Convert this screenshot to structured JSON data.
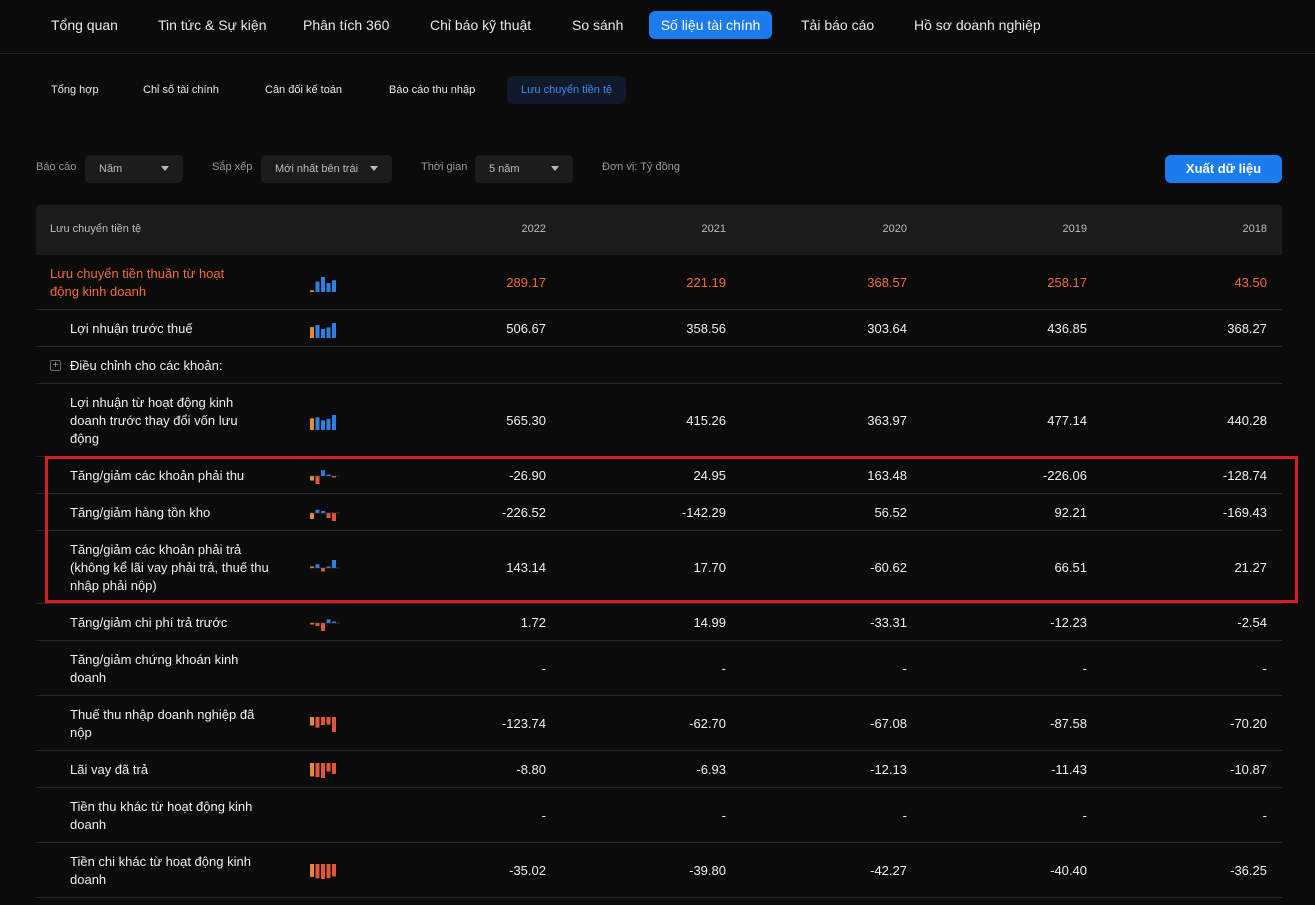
{
  "top_nav": [
    {
      "label": "Tổng quan",
      "active": false
    },
    {
      "label": "Tin tức & Sự kiện",
      "active": false
    },
    {
      "label": "Phân tích 360",
      "active": false
    },
    {
      "label": "Chỉ báo kỹ thuật",
      "active": false
    },
    {
      "label": "So sánh",
      "active": false
    },
    {
      "label": "Số liệu tài chính",
      "active": true
    },
    {
      "label": "Tải báo cáo",
      "active": false
    },
    {
      "label": "Hồ sơ doanh nghiệp",
      "active": false
    }
  ],
  "sub_nav": [
    {
      "label": "Tổng hợp",
      "active": false
    },
    {
      "label": "Chỉ số tài chính",
      "active": false
    },
    {
      "label": "Cân đối kế toán",
      "active": false
    },
    {
      "label": "Báo cáo thu nhập",
      "active": false
    },
    {
      "label": "Lưu chuyển tiền tệ",
      "active": true
    }
  ],
  "filters": {
    "report_label": "Báo cáo",
    "report_value": "Năm",
    "sort_label": "Sắp xếp",
    "sort_value": "Mới nhất bên trái",
    "time_label": "Thời gian",
    "time_value": "5 năm",
    "unit_label": "Đơn vị: Tỷ đồng",
    "export_label": "Xuất dữ liệu"
  },
  "colors": {
    "accent": "#1b7cf0",
    "highlight_text": "#f06a3a",
    "positive_bar": "#2f7fe0",
    "negative_bar": "#e0563a",
    "orange_bar": "#e8892e",
    "highlight_box": "#d71c22"
  },
  "table": {
    "header_label": "Lưu chuyển tiền tệ",
    "years": [
      "2022",
      "2021",
      "2020",
      "2019",
      "2018"
    ],
    "rows": [
      {
        "name": "Lưu chuyển tiền thuần từ hoạt động kinh doanh",
        "values": [
          "289.17",
          "221.19",
          "368.57",
          "258.17",
          "43.50"
        ],
        "spark": true
      },
      {
        "name": "Lợi nhuận trước thuế",
        "values": [
          "506.67",
          "358.56",
          "303.64",
          "436.85",
          "368.27"
        ],
        "spark": true
      },
      {
        "name": "Điều chỉnh cho các khoản:",
        "values": [],
        "spark": false
      },
      {
        "name": "Lợi nhuận từ hoạt động kinh doanh trước thay đổi vốn lưu động",
        "values": [
          "565.30",
          "415.26",
          "363.97",
          "477.14",
          "440.28"
        ],
        "spark": true
      },
      {
        "name": "Tăng/giảm các khoản phải thu",
        "values": [
          "-26.90",
          "24.95",
          "163.48",
          "-226.06",
          "-128.74"
        ],
        "spark": true
      },
      {
        "name": "Tăng/giảm hàng tồn kho",
        "values": [
          "-226.52",
          "-142.29",
          "56.52",
          "92.21",
          "-169.43"
        ],
        "spark": true
      },
      {
        "name": "Tăng/giảm các khoản phải trả (không kể lãi vay phải trả, thuế thu nhập phải nộp)",
        "values": [
          "143.14",
          "17.70",
          "-60.62",
          "66.51",
          "21.27"
        ],
        "spark": true
      },
      {
        "name": "Tăng/giảm chi phí trả trước",
        "values": [
          "1.72",
          "14.99",
          "-33.31",
          "-12.23",
          "-2.54"
        ],
        "spark": true
      },
      {
        "name": "Tăng/giảm chứng khoán kinh doanh",
        "values": [
          "-",
          "-",
          "-",
          "-",
          "-"
        ],
        "spark": false
      },
      {
        "name": "Thuế thu nhập doanh nghiệp đã nộp",
        "values": [
          "-123.74",
          "-62.70",
          "-67.08",
          "-87.58",
          "-70.20"
        ],
        "spark": true
      },
      {
        "name": "Lãi vay đã trả",
        "values": [
          "-8.80",
          "-6.93",
          "-12.13",
          "-11.43",
          "-10.87"
        ],
        "spark": true
      },
      {
        "name": "Tiền thu khác từ hoạt động kinh doanh",
        "values": [
          "-",
          "-",
          "-",
          "-",
          "-"
        ],
        "spark": false
      },
      {
        "name": "Tiền chi khác từ hoạt động kinh doanh",
        "values": [
          "-35.02",
          "-39.80",
          "-42.27",
          "-40.40",
          "-36.25"
        ],
        "spark": true
      }
    ]
  }
}
